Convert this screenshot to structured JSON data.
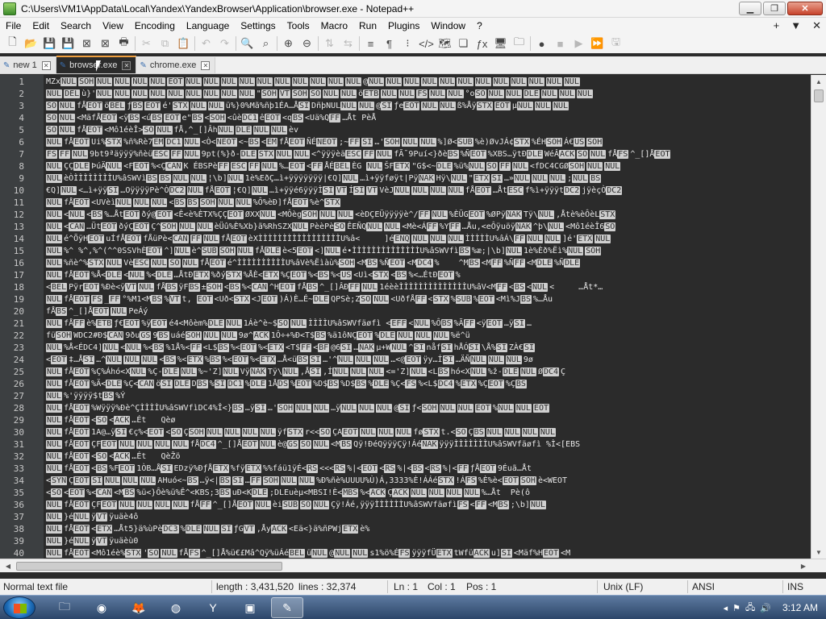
{
  "window": {
    "title": "C:\\Users\\VM1\\AppData\\Local\\Yandex\\YandexBrowser\\Application\\browser.exe - Notepad++",
    "minimize": "▁",
    "maximize": "❐",
    "close": "✕"
  },
  "menu": {
    "items": [
      "File",
      "Edit",
      "Search",
      "View",
      "Encoding",
      "Language",
      "Settings",
      "Tools",
      "Macro",
      "Run",
      "Plugins",
      "Window",
      "?"
    ],
    "right": [
      "+",
      "▼",
      "✕"
    ]
  },
  "toolbar": {
    "icons": [
      {
        "name": "new-file-icon",
        "glyph": "🗋",
        "dim": false
      },
      {
        "name": "open-file-icon",
        "glyph": "📂",
        "dim": false
      },
      {
        "name": "save-icon",
        "glyph": "💾",
        "dim": true
      },
      {
        "name": "save-all-icon",
        "glyph": "💾",
        "dim": false
      },
      {
        "name": "close-file-icon",
        "glyph": "⊠",
        "dim": false
      },
      {
        "name": "close-all-icon",
        "glyph": "⊠",
        "dim": false
      },
      {
        "name": "print-icon",
        "glyph": "🖶",
        "dim": false
      },
      {
        "name": "cut-icon",
        "glyph": "✂",
        "dim": true
      },
      {
        "name": "copy-icon",
        "glyph": "⧉",
        "dim": true
      },
      {
        "name": "paste-icon",
        "glyph": "📋",
        "dim": true
      },
      {
        "name": "undo-icon",
        "glyph": "↶",
        "dim": true
      },
      {
        "name": "redo-icon",
        "glyph": "↷",
        "dim": true
      },
      {
        "name": "find-icon",
        "glyph": "🔍",
        "dim": false
      },
      {
        "name": "replace-icon",
        "glyph": "⌕",
        "dim": false
      },
      {
        "name": "zoom-in-icon",
        "glyph": "⊕",
        "dim": false
      },
      {
        "name": "zoom-out-icon",
        "glyph": "⊖",
        "dim": false
      },
      {
        "name": "sync-vertical-icon",
        "glyph": "⇅",
        "dim": true
      },
      {
        "name": "sync-horizontal-icon",
        "glyph": "⇆",
        "dim": true
      },
      {
        "name": "word-wrap-icon",
        "glyph": "≡",
        "dim": false
      },
      {
        "name": "show-all-chars-icon",
        "glyph": "¶",
        "dim": false
      },
      {
        "name": "indent-guide-icon",
        "glyph": "⁝",
        "dim": false
      },
      {
        "name": "udl-icon",
        "glyph": "</>",
        "dim": false
      },
      {
        "name": "doc-map-icon",
        "glyph": "🗺",
        "dim": false
      },
      {
        "name": "doc-list-icon",
        "glyph": "❏",
        "dim": false
      },
      {
        "name": "function-list-icon",
        "glyph": "ƒx",
        "dim": false
      },
      {
        "name": "monitor-icon",
        "glyph": "🖥",
        "dim": false
      },
      {
        "name": "folder-workspace-icon",
        "glyph": "🗀",
        "dim": false
      },
      {
        "name": "record-macro-icon",
        "glyph": "●",
        "dim": false
      },
      {
        "name": "stop-macro-icon",
        "glyph": "■",
        "dim": true
      },
      {
        "name": "play-macro-icon",
        "glyph": "▶",
        "dim": true
      },
      {
        "name": "run-macro-multiple-icon",
        "glyph": "⏩",
        "dim": false
      },
      {
        "name": "save-macro-icon",
        "glyph": "🖫",
        "dim": true
      }
    ]
  },
  "tabs": [
    {
      "label": "new 1",
      "active": false
    },
    {
      "label": "browser.exe",
      "active": true
    },
    {
      "label": "chrome.exe",
      "active": false
    }
  ],
  "editor": {
    "line_numbers": [
      "1",
      "2",
      "3",
      "4",
      "5",
      "6",
      "7",
      "8",
      "9",
      "10",
      "11",
      "12",
      "13",
      "14",
      "15",
      "16",
      "17",
      "18",
      "19",
      "20",
      "21",
      "22",
      "23",
      "24",
      "25",
      "26",
      "27",
      "28",
      "29",
      "30",
      "31",
      "32",
      "33",
      "34",
      "35",
      "36",
      "37",
      "38",
      "39",
      "40"
    ],
    "lines": [
      "MZx[NUL][SOH][NUL][NUL][NUL][NUL][EOT][NUL][NUL][NUL][NUL][NUL][NUL][NUL][NUL][NUL][NUL]@[NUL][NUL][NUL][NUL][NUL][NUL][NUL][NUL][NUL][NUL][NUL][NUL]",
      "[NUL][DEL]ù}'[NUL][NUL][NUL][NUL][NUL][NUL][NUL][NUL][NUL]\"[SOH][VT][SOH][SO][NUL][NUL]ö[ETB][NUL][NUL][FS][NUL][NUL]°o[SO][NUL][NUL][DLE][NUL][NUL][NUL]",
      "[SO][NUL]fÅ[EOT]ö[BEL]ƒ[BS][EOT]é'[STX][NUL][NUL]ü%}0%Mã%ñþ1ÉA…Å[SI]DñþNUL[NUL][NUL]@[SI]ƒe[EOT][NUL][NUL]ß%Åÿ[STX][EOT]µ[NUL][NUL][NUL]",
      "[SO][NUL]<MäfÅ[EOT]<ÿ[BS]<ú[BS][EOT]e\"[BS]<[SOH]<ûè[DC1]ê[EOT]<q[BS]<Uä%Q[FF]…Åt PèÅ",
      "[SO][NUL]fÅ[EOT]<Mô1éèÎ>[SO][NUL]fÅ,^_[]Âh[NUL][DLE][NUL][NUL]èv",
      "[NUL]fÅ[EOT]Ui%[STX]%ñ%Rè7[EM][DC1][NUL]<Ò<[NEOT]<~[BS]<[EM]fÅ[EOT]ÑÉ[NEOT];~[FF][SI]…'[SOH][NUL][NUL]%]Ø<[SUB]%è)ØvJÁ¢[STX]%ÉH[SOH]Á€[US][SOH]",
      "[FS][FF][NUL]9bt9ªäÿÿÿ%ñèü[ESC][FF][NUL]9pt(%}ð-[DLE][STX][NUL][NUL]<^ÿÿÿèä[ESC][FF][NUL]fÃ¯9Puí<}ðè[BS]%Ñ[EOT]%XBS…ÿtÐ[DLE]WéÂ[ACK][SO][NUL]fÅ[FS]^_[]Å[EOT]",
      "[NUL]ÇÇ[DLE]ÞúÄ[NUL]<F[EOT]%<Ç[CAN]K ÉBSPè[FF][ESC][FF][NUL]%…[EOT]<[FF]ÅÉ[BEL]ÈG [NUL]ŠF[ETX]\"G$<~[DLE]%ü%[NUL][SO][FF][NUL]<fDC4CGØ[SOH][NUL][NUL]",
      "[NUL]èÒÌÌÌÌÌÌÌÌU%âSWVì[BS][BS][NUL][NUL]¦\\b][NUL]1è%EðÇ…ì+ÿÿÿÿÿÿÿ|€Q][NUL]…ì+ÿÿføÿt|Pÿ[NAK]Hÿ\\[NUL]\"[ETX][SI]…»[NUL][NUL][NUL];[NUL][BS]",
      "€Q][NUL]<…ì+ÿÿ[SI]…OÿÿÿÿPè^Ò[DC2][NUL]fÅ[EOT]¦€Q][NUL]…ì+ÿÿé6ÿÿÿÌ[SI][VT]Í[SI][VT]VèJ[NUL][NUL][NUL][NUL]fÅ[EOT]…Åt[ESC]f%ì+ÿÿÿt[DC2]jÿèçÒ[DC2]",
      "[NUL]fÅ[EOT]<UVèì[NUL][NUL][NUL]<[BS][BS][SOH][NUL][NUL]%Ô%èÐ]fÅ[EOT]%è^[STX]",
      "[NUL]<[NUL]<[BS]%…Åt[EOT]ðý@[EOT]<Ê<è%ÈTX%ÇÇ[EOT]ØXX[NUL]<MÔèg[SOH][NUL][NUL]<èDÇEÜÿÿÿÿè^/[FF][NUL]%ÈÜG[EOT]%ØPÿ[NAK]Tÿ\\[NUL],Åtè%èÔèL[STX]",
      "[NUL]<[CAN]…Üt[EOT]ðýÇ[EOT]Ç^[SOH][NUL][NUL]èÜû%È%Xb}ã%RhSZX[NUL]PèèPè[SO]ÊEÑQ[NUL][NUL]<Mè<Á[FF]%Y[FF]…Åu,<eÔÿuöÿ[NAK]^þ\\[NUL]<Mô1éèÎ6[SO]",
      "[NUL]é^ÕÿH[EOT]uÍfÅ[EOT]fÅüPè<[CAN][FF][NUL]fÅ[EOT]èXÌÌÌÌÌÌÌÌÌÌÌÌÌÌÌÌÌU%â<     ]é[ENQ][NUL][NUL][NUL]ÌÌÌÌÌU%âÁ\\[FF][NUL][NUL]]é'[ETX][NUL]",
      "[NUL]%^ %^,%^(^^0SSVhÈ[EOT]^][NUL]è^[SUB][SOH][NUL]fÅ[DLE]è<5[EOT]<][NUL]é•ÌÌÌÌÌÌÌÌÌÌÌÌÌÌU%âSWVfì[BS]%æ;|\\b][NUL]1è%Èð%Ëì%[NUL][SOH]",
      "[NUL]%ñè^%[STX][NUL]Vè[ESC][NUL][SO][NUL]fÅ[EOT]é^ÌÌÌÌÌÌÌÌÌÌU%âVè%Ëìàù%[SOH]<M[BS]%Ñ[EOT]<M[DC4]%    ^M[BS]<M[FF]%Ñ[FF]<M[DLE]%Ñ[DLE]",
      "[NUL]fÅ[EOT]%Å<[DLE]<[NUL]%<[DLE]…ÅtÐ[ETX]%ðý[STX]%ÅÈ<[ETX]%Ç[EOT]%<[BS]%<[US]<Uì<[STX]<[BS]%<…ÉtÐ[EOT]%",
      "<[BEL]Pÿr[EOT]%Ðè<ÿ[VT][NUL]fÅ[BS]ÿF[BS]±[SOH]<[BS]%<[CAN]^H[EOT]fÅ[BS]^_[]ÂÐ[FF][NUL]1éèèÌÌÌÌÌÌÌÌÌÌÌÌÌÌU%âV<M[FF]<[BS]<[NUL]<     …Åt*…",
      "[NUL]fÅ[EOT][FS]_[FF]°%M1<M[BS]%[VT]t, [EOT]<Uð<[STX]<J[EOT])Á)È…É~[DLE]QPSè;Z[SO][NUL]<UðfÅ[FF]<[STX]%[SUB]%[EOT]<Mì%J[BS]%…Åu",
      "fÅ[BS]^_[]Å[EOT][NUL]PeÁý",
      "[NUL]fÅ[FF]è%[ETB]ƒ€[EOT]%ÿ[EOT]é4<Môèm%[DLE][NUL]1Áè^è~$[SO][NUL]ÌÌÌÌU%âSWVfäøfì <[EFF]<[NUL]%Ô[BS]%Ã[FF]<ÿ[EOT]…ÿ[SI]…",
      "fü[SOH]WDC2#Ð$[CAN]9ðu[GS]9[BS]uáé[SOH][NUL][NUL]9ø^[ACK]1Ô÷+%Ð<T$[BS]%ä1ôNÇ[EOT]%[DLE][NUL][NUL][NUL]%ë^ü",
      "[NUL]%Å<ÉDC4][NUL]<[NUL]%<[BS]%1Å%<[FF]<L$[BS]%<[EOT]%<[ETX]<T$[FF]<[BF]@6[SI]…[NAK]µ+W[NUL]^[SI]nåf[SI]hÅÓ[SI]\\Å%[SI]ZÀ€[SI]",
      "<[EOT]‡…Å[SI]…^[NUL][NUL][NUL]<[BS]%<[ETX]%[BS]%<[EOT]%<[ETX]…Å<ü[BS][SI]…'^[NUL][NUL][NUL]…<@[EOT]ÿy…Í[SI]…ÄÑ[NUL][NUL][NUL]9ø",
      "[NUL]fÅ[EOT]%Ç%Áhó<X[NUL]%Ç-[DLE][NUL]%~'Z][NUL]Vÿ[NAK]Tÿ\\[NUL],Å[SI],Í[NUL][NUL][NUL]<='Z][NUL]<L[BS]hó<X[NUL]%ž-[DLE][NUL]Ø[DC4]Ç",
      "[NUL]fÅ[EOT]%Ä<[DLE]%Ç<[CAN]ö[SI][DLE]D[BS]%[SI][DC1]%[DLE]1Å[DS]%[EOT]%D$[BS]%D$[BS]%[DLE]%Ç<[FS]%<L$[DC4]%[ETX]%Ç[EOT]%Ç[BS]",
      "[NUL]%'ÿÿÿÿ$t[BS]%Ý",
      "[NUL]fÅ[EOT]%Wÿÿÿ%Ðè^ÇÌÌÌÌU%âSWVfìDC4%Î<}[BS]…ÿ[SI]…'[SOH][NUL][NUL]…ÿ[NUL][NUL][NUL]@[SI]ƒ<[SOH][NUL][NUL][EOT]%[NUL][NUL][EOT]",
      "[NUL]fÅ[EOT]<[SO]<[ACK]…Ét   Qèø",
      "[NUL]fÅ[EOT]1A@…ÿ[SI]€ç%<[EOT]<[SO]Ç[SOH][NUL][NUL][NUL][NUL]ÿf[STX]r<<[SO]ÇA[EOT][NUL][NUL][NUL]fø[STX]t.<[SO]Ç[BS][NUL][NUL][NUL][NUL]",
      "[NUL]fÅ[EOT]ÇF[EOT][NUL][NUL][NUL][NUL]fÅ[DC4]^_[]Å[EOT][NUL]è@[GS][SO][NUL]<M[BS]Qÿ!ÐéQÿÿÿÇÿ!Áé[NAK]ÿÿÿÌÌÌÌÌÌÌU%âSWVfäøfì %Ì<[EBS",
      "[NUL]fÅ[EOT]<[SO]<[ACK]…Ét   QèŽö",
      "[NUL]fÅ[EOT]<[BS]%F[EOT]1ÒB…Å[SI]EDzÿ%ÐƒÅ[ETX]%fÿ[ETX]%%fáü1ÿÉ<[RS]<<<[RS]%|<[EOT]<[RS]%|<[BS]<[RS]%|<[FF]ƒÅ[EOT]9Éuã…Åt",
      "<[SYN]Ç[EOT][SI][NUL][NUL][NUL]AHuó<~[BS]…ÿ<|[BS][SI]…[FF][SOH][NUL][NUL]%Ð%ñè%UUUU%Ù)Á,3333%È!ÁÁé[STX]!Á[FS]%È%è<[EOT][SOH]è<WEOT",
      "<[SO]<[EOT]%<[CAN]<M[BS]%ü<}Ôè%ü%Ê^<KBS;3[BS]uÐ<K[DLE];DLEuèµ<MBSI!È<[MBS]%<[ACK]Ç[ACK][NUL][NUL][NUL][NUL]%…Åt  Pè(ô",
      "[NUL]fÅ[EOT]ÇF[EOT][NUL][NUL][NUL][NUL]fÅ[FF]^_[]Å[EOT][NUL]èi[SUB][SO][NUL]Çÿ!Áé,ÿÿÿÌÌÌÌÌÌU%âSWVfäøfì[FS]<[FF]<M[BS];\\b][NUL]",
      "[NUL]}é[NUL]ÿ[VT]ÿuäè4ô",
      "[NUL]fÅ[EOT]<[ETX]…Åt5}ä%ùPè[DC3]%[DLE][NUL][SI]ƒG[VT],Åy[ACK]<Eä<}ä%ñPWj[ETX]è%",
      "[NUL]}é[NUL]ÿ[VT]ÿuäèù0",
      "[NUL]fÅ[EOT]<Mô1éè%[STX]'[SO][NUL]fÅ[FS]^_[]Å%ü€£Mâ^Qÿ%üÁé[BEL]ü[NUL]@[NUL][NUL]s1%ö%É[FS]ÿÿÿfÜ[ETX]tWfü[ACK]u][SI]<Mäf%H[EOT]<M"
    ]
  },
  "status": {
    "type": "Normal text file",
    "length": "length : 3,431,520",
    "lines": "lines : 32,374",
    "ln": "Ln : 1",
    "col": "Col : 1",
    "pos": "Pos : 1",
    "eol": "Unix (LF)",
    "encoding": "ANSI",
    "mode": "INS"
  },
  "taskbar": {
    "clock": "3:12 AM",
    "apps": [
      "explorer",
      "chrome",
      "firefox",
      "dev",
      "yandex",
      "network",
      "notepad++"
    ]
  },
  "colors": {
    "editor_bg": "#2b2b2b",
    "control_char_bg": "#cfcfcf",
    "tab_accent": "#f0a040"
  }
}
